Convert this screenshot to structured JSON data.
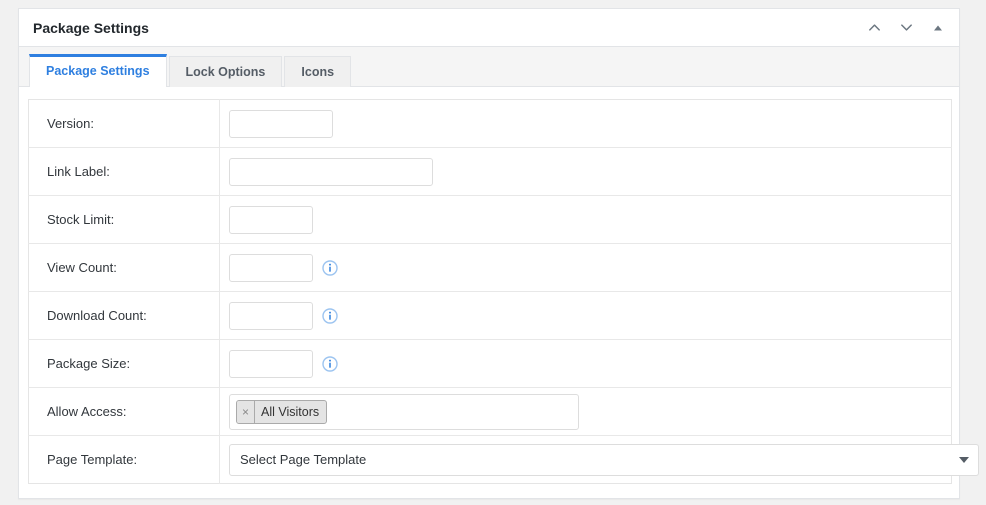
{
  "panel": {
    "title": "Package Settings",
    "header_actions": [
      {
        "name": "move-up-icon",
        "label": "Move up"
      },
      {
        "name": "move-down-icon",
        "label": "Move down"
      },
      {
        "name": "toggle-collapse-icon",
        "label": "Toggle panel"
      }
    ]
  },
  "tabs": [
    {
      "label": "Package Settings",
      "active": true
    },
    {
      "label": "Lock Options",
      "active": false
    },
    {
      "label": "Icons",
      "active": false
    }
  ],
  "form": {
    "rows": [
      {
        "label": "Version:",
        "value": "",
        "placeholder": ""
      },
      {
        "label": "Link Label:",
        "value": "",
        "placeholder": ""
      },
      {
        "label": "Stock Limit:",
        "value": "",
        "placeholder": ""
      },
      {
        "label": "View Count:",
        "value": "",
        "placeholder": ""
      },
      {
        "label": "Download Count:",
        "value": "",
        "placeholder": ""
      },
      {
        "label": "Package Size:",
        "value": "",
        "placeholder": ""
      },
      {
        "label": "Allow Access:",
        "value": "",
        "placeholder": ""
      },
      {
        "label": "Page Template:",
        "value": "",
        "placeholder": ""
      }
    ],
    "allow_access": {
      "token_label": "All Visitors",
      "token_remove": "×"
    },
    "page_template": {
      "selected": "Select Page Template",
      "options": [
        "Select Page Template"
      ]
    }
  },
  "colors": {
    "accent": "#2e7fe0",
    "info_icon": "#3a87e0",
    "page_background": "#f1f1f1",
    "panel_background": "#ffffff",
    "border": "#e2e4e7"
  }
}
